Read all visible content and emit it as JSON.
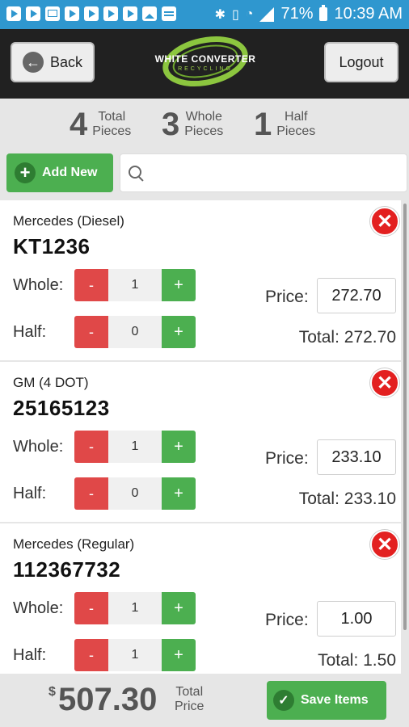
{
  "status_bar": {
    "battery": "71%",
    "time": "10:39 AM",
    "left_icons": [
      "youtube-icon",
      "youtube-icon",
      "mail-icon",
      "youtube-icon",
      "youtube-icon",
      "youtube-icon",
      "youtube-icon",
      "image-icon",
      "calendar-icon"
    ],
    "right_icons": [
      "bluetooth-icon",
      "vibrate-icon",
      "wifi-icon",
      "signal-icon",
      "battery-icon"
    ]
  },
  "header": {
    "back_label": "Back",
    "logout_label": "Logout",
    "logo_text": "WHITE CONVERTER",
    "logo_sub": "RECYCLING"
  },
  "summary": [
    {
      "value": "4",
      "label_line1": "Total",
      "label_line2": "Pieces"
    },
    {
      "value": "3",
      "label_line1": "Whole",
      "label_line2": "Pieces"
    },
    {
      "value": "1",
      "label_line1": "Half",
      "label_line2": "Pieces"
    }
  ],
  "toolbar": {
    "add_new_label": "Add New",
    "search_placeholder": ""
  },
  "items": [
    {
      "name": "Mercedes (Diesel)",
      "code": "KT1236",
      "whole_label": "Whole:",
      "whole_value": "1",
      "half_label": "Half:",
      "half_value": "0",
      "minus": "-",
      "plus": "+",
      "price_label": "Price:",
      "price_value": "272.70",
      "total_text": "Total: 272.70"
    },
    {
      "name": "GM (4 DOT)",
      "code": "25165123",
      "whole_label": "Whole:",
      "whole_value": "1",
      "half_label": "Half:",
      "half_value": "0",
      "minus": "-",
      "plus": "+",
      "price_label": "Price:",
      "price_value": "233.10",
      "total_text": "Total: 233.10"
    },
    {
      "name": "Mercedes (Regular)",
      "code": "112367732",
      "whole_label": "Whole:",
      "whole_value": "1",
      "half_label": "Half:",
      "half_value": "1",
      "minus": "-",
      "plus": "+",
      "price_label": "Price:",
      "price_value": "1.00",
      "total_text": "Total: 1.50"
    }
  ],
  "footer": {
    "currency": "$",
    "total_amount": "507.30",
    "total_label_line1": "Total",
    "total_label_line2": "Price",
    "save_label": "Save Items"
  },
  "colors": {
    "status_bar": "#2f97cf",
    "header": "#212121",
    "green": "#4caf50",
    "red": "#e04848",
    "delete_red": "#e32020"
  }
}
